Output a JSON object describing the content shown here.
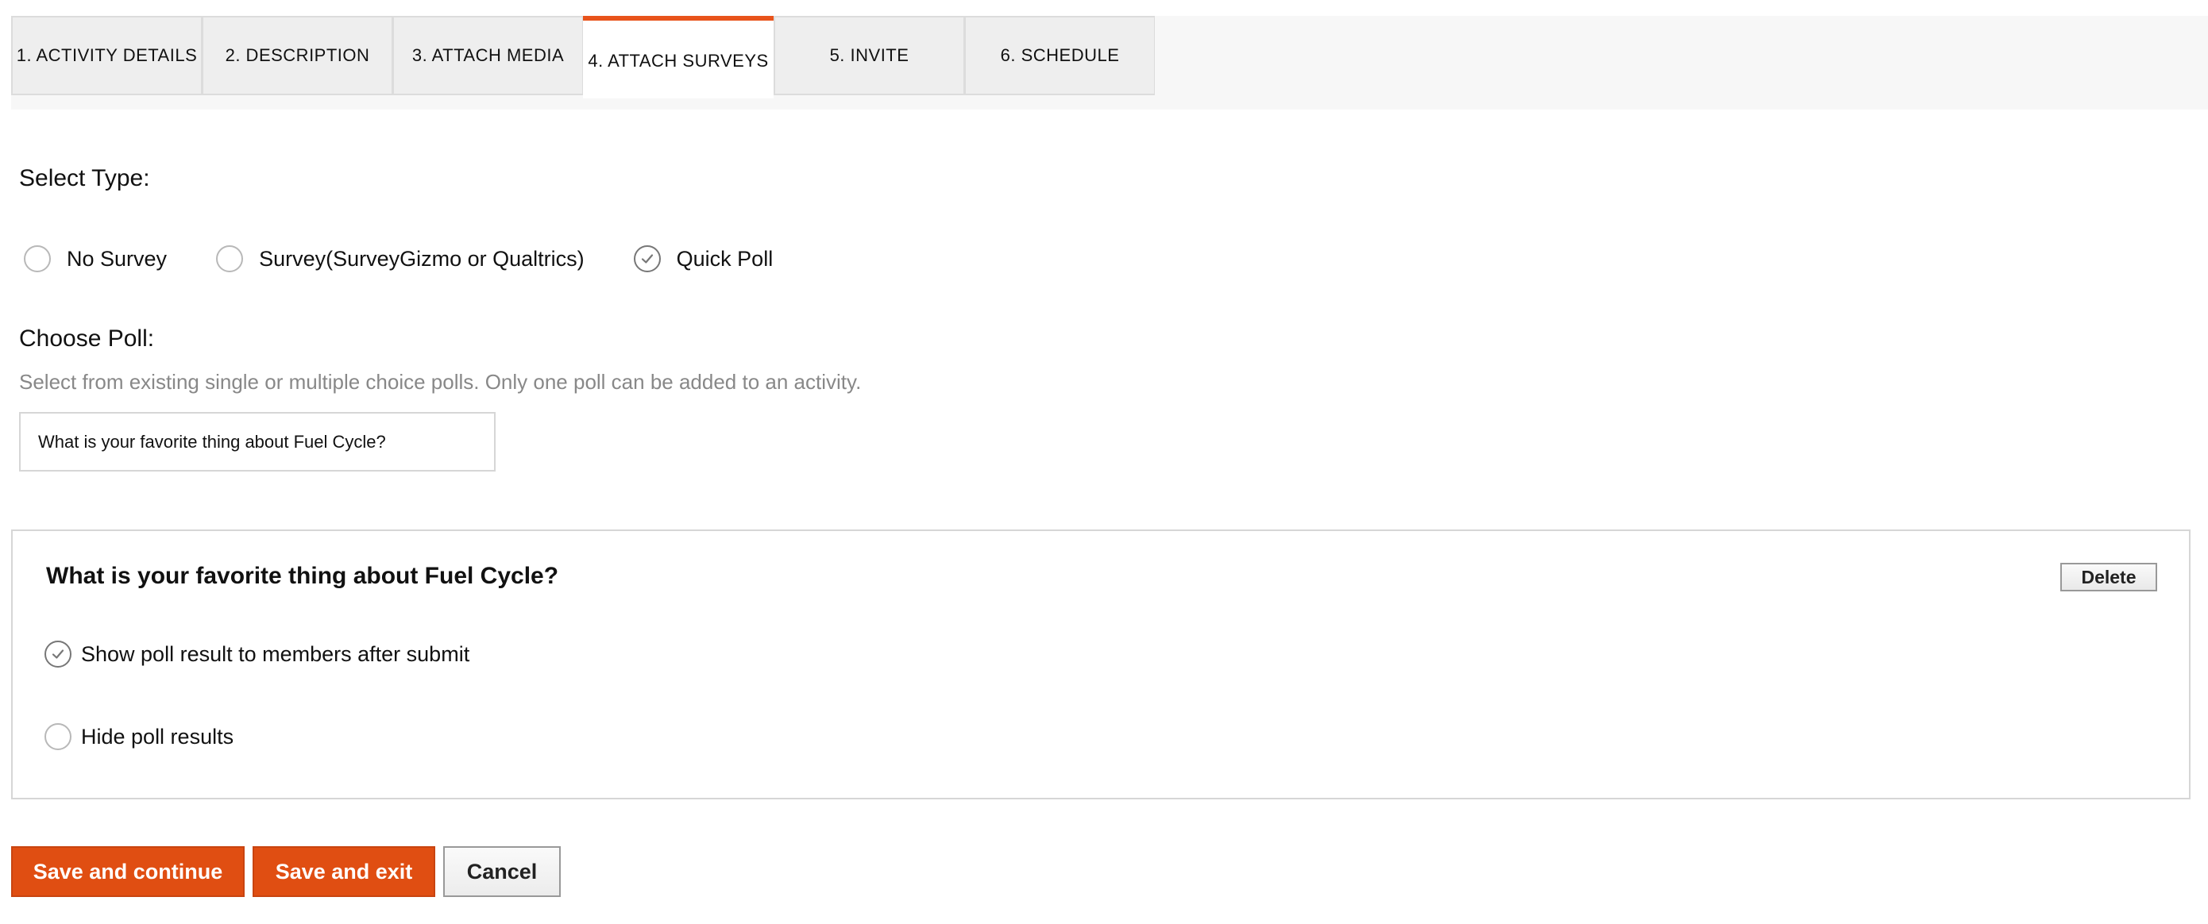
{
  "tabs": [
    {
      "label": "1. ACTIVITY DETAILS",
      "active": false
    },
    {
      "label": "2. DESCRIPTION",
      "active": false
    },
    {
      "label": "3. ATTACH MEDIA",
      "active": false
    },
    {
      "label": "4. ATTACH SURVEYS",
      "active": true
    },
    {
      "label": "5. INVITE",
      "active": false
    },
    {
      "label": "6. SCHEDULE",
      "active": false
    }
  ],
  "select_type": {
    "label": "Select Type:",
    "options": [
      {
        "label": "No Survey",
        "checked": false
      },
      {
        "label": "Survey(SurveyGizmo or Qualtrics)",
        "checked": false
      },
      {
        "label": "Quick Poll",
        "checked": true
      }
    ]
  },
  "choose_poll": {
    "label": "Choose Poll:",
    "hint": "Select from existing single or multiple choice polls. Only one poll can be added to an activity.",
    "value": "What is your favorite thing about Fuel Cycle?"
  },
  "poll_card": {
    "title": "What is your favorite thing about Fuel Cycle?",
    "delete_label": "Delete",
    "options": [
      {
        "label": "Show poll result to members after submit",
        "checked": true
      },
      {
        "label": "Hide poll results",
        "checked": false
      }
    ]
  },
  "buttons": {
    "save_continue": "Save and continue",
    "save_exit": "Save and exit",
    "cancel": "Cancel"
  },
  "colors": {
    "accent": "#e8531b",
    "primary_button": "#e04e12"
  }
}
